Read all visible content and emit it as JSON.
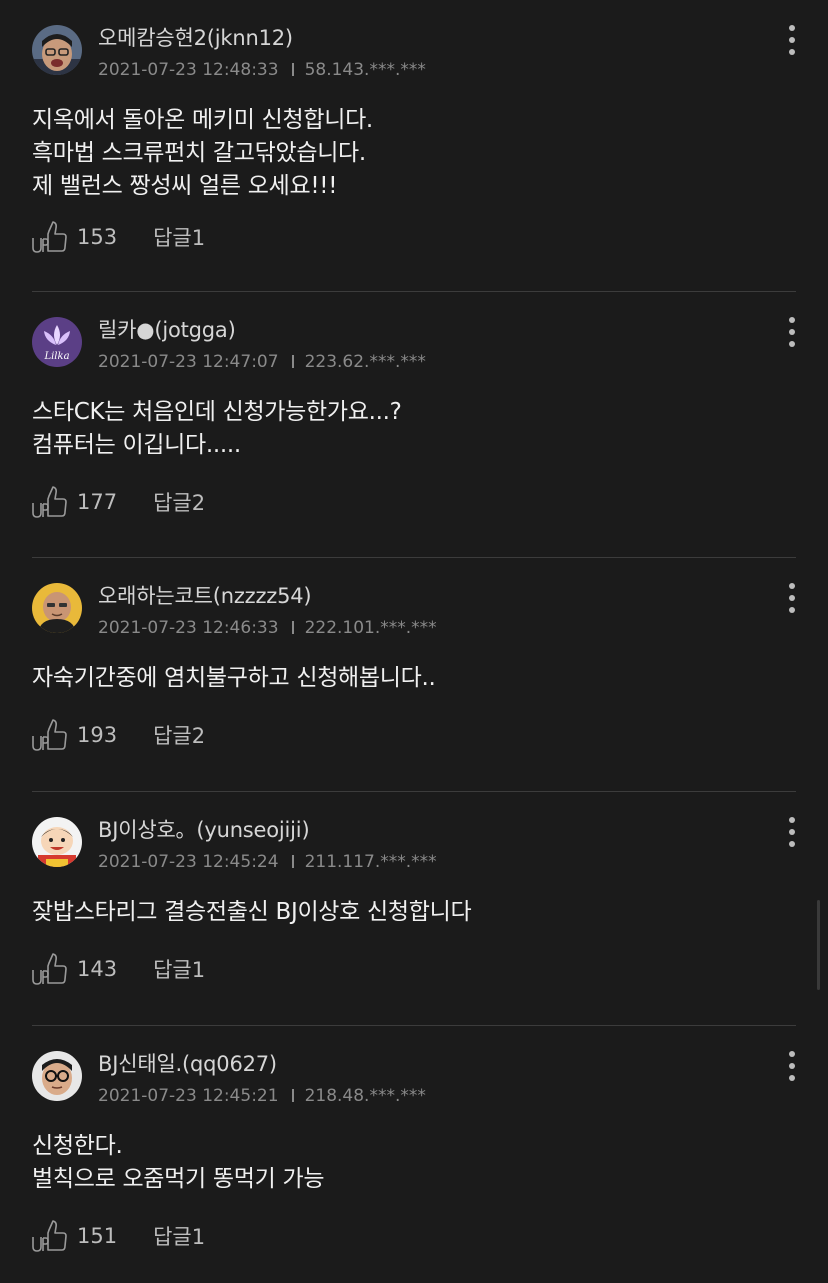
{
  "comments": [
    {
      "nick": "오메캄승현2(jknn12)",
      "date": "2021-07-23 12:48:33",
      "ip": "58.143.***.***",
      "body": "지옥에서 돌아온 메키미 신청합니다.\n흑마법 스크류펀치 갈고닦았습니다.\n제 밸런스 짱성씨 얼른 오세요!!!",
      "up_count": "153",
      "reply_label": "답글1",
      "avatar_icon": "user-avatar"
    },
    {
      "nick": "릴카●(jotgga)",
      "date": "2021-07-23 12:47:07",
      "ip": "223.62.***.***",
      "body": "스타CK는 처음인데 신청가능한가요...?\n컴퓨터는 이깁니다.....",
      "up_count": "177",
      "reply_label": "답글2",
      "avatar_icon": "lotus-logo-avatar",
      "avatar_text": "Lilka"
    },
    {
      "nick": "오래하는코트(nzzzz54)",
      "date": "2021-07-23 12:46:33",
      "ip": "222.101.***.***",
      "body": "자숙기간중에 염치불구하고 신청해봅니다..",
      "up_count": "193",
      "reply_label": "답글2",
      "avatar_icon": "user-avatar"
    },
    {
      "nick": "BJ이상호。(yunseojiji)",
      "date": "2021-07-23 12:45:24",
      "ip": "211.117.***.***",
      "body": "잦밥스타리그 결승전출신 BJ이상호 신청합니다",
      "up_count": "143",
      "reply_label": "답글1",
      "avatar_icon": "cartoon-avatar"
    },
    {
      "nick": "BJ신태일.(qq0627)",
      "date": "2021-07-23 12:45:21",
      "ip": "218.48.***.***",
      "body": "신청한다.\n벌칙으로 오줌먹기 똥먹기 가능",
      "up_count": "151",
      "reply_label": "답글1",
      "avatar_icon": "user-avatar"
    }
  ],
  "colors": {
    "background": "#1b1b1b",
    "text": "#f0f0f0",
    "muted": "#8a8a8a",
    "divider": "#3c3c3c"
  },
  "icons": {
    "like": "thumbs-up-icon",
    "more": "more-vertical-icon"
  }
}
